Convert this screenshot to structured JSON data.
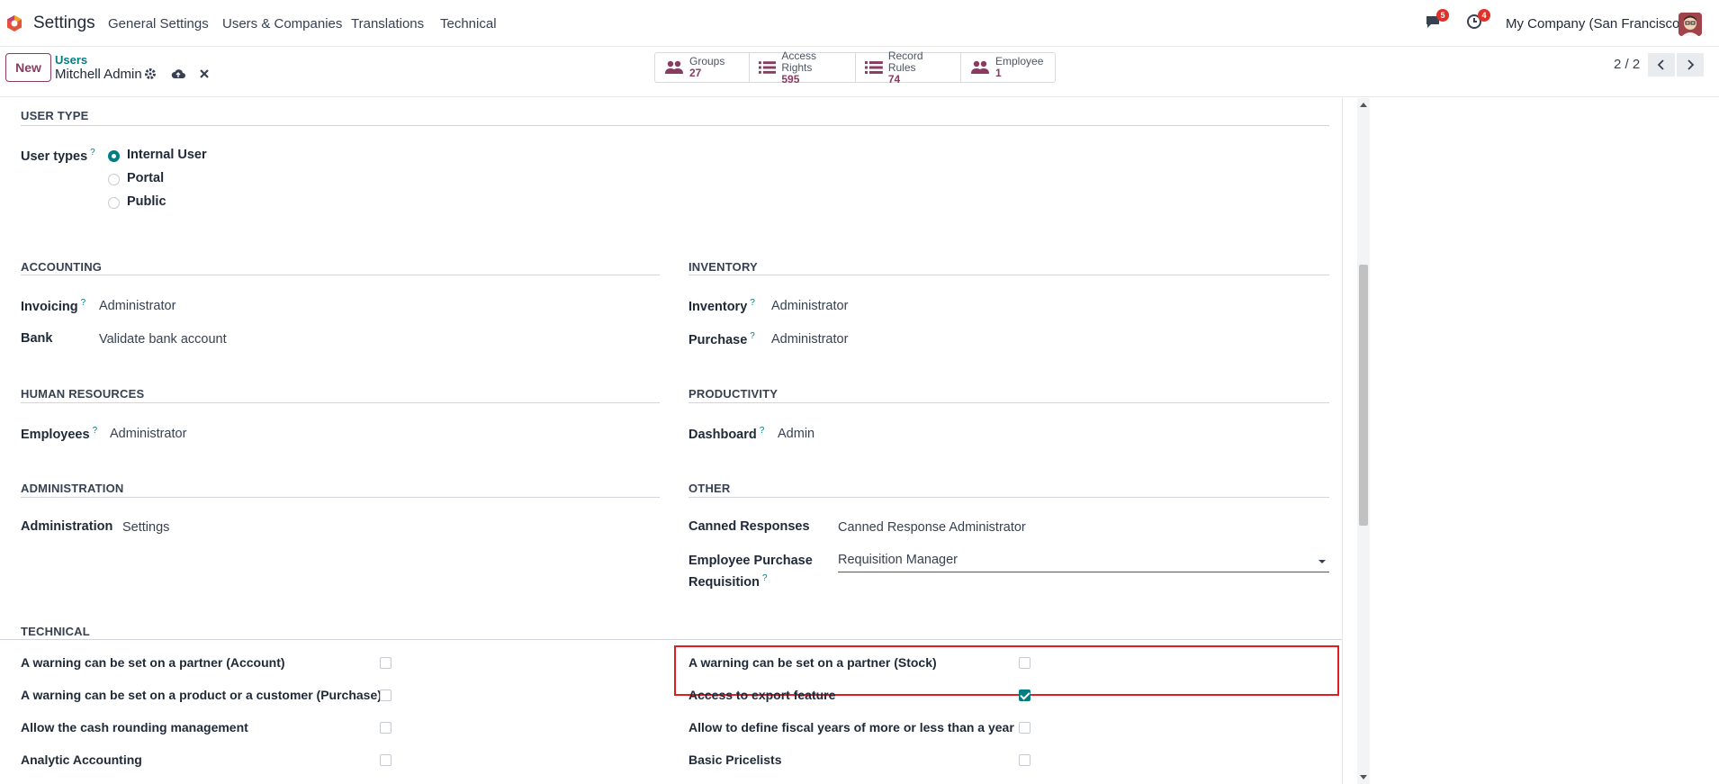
{
  "navbar": {
    "app_name": "Settings",
    "menus": [
      "General Settings",
      "Users & Companies",
      "Translations",
      "Technical"
    ],
    "messages_count": "5",
    "activities_count": "4",
    "company": "My Company (San Francisco)"
  },
  "control_panel": {
    "new_label": "New",
    "breadcrumb_parent": "Users",
    "breadcrumb_current": "Mitchell Admin",
    "smart_buttons": [
      {
        "label": "Groups",
        "value": "27",
        "icon": "users-icon"
      },
      {
        "label": "Access Rights",
        "value": "595",
        "icon": "list-icon"
      },
      {
        "label": "Record Rules",
        "value": "74",
        "icon": "list-icon"
      },
      {
        "label": "Employee",
        "value": "1",
        "icon": "users-icon"
      }
    ],
    "pager": "2 / 2"
  },
  "user_type": {
    "title": "USER TYPE",
    "label": "User types",
    "options": [
      "Internal User",
      "Portal",
      "Public"
    ],
    "selected": "Internal User"
  },
  "sections": {
    "accounting": {
      "title": "ACCOUNTING",
      "fields": [
        {
          "label": "Invoicing",
          "value": "Administrator",
          "help": "?"
        },
        {
          "label": "Bank",
          "value": "Validate bank account"
        }
      ]
    },
    "inventory": {
      "title": "INVENTORY",
      "fields": [
        {
          "label": "Inventory",
          "value": "Administrator",
          "help": "?"
        },
        {
          "label": "Purchase",
          "value": "Administrator",
          "help": "?"
        }
      ]
    },
    "human_resources": {
      "title": "HUMAN RESOURCES",
      "fields": [
        {
          "label": "Employees",
          "value": "Administrator",
          "help": "?"
        }
      ]
    },
    "productivity": {
      "title": "PRODUCTIVITY",
      "fields": [
        {
          "label": "Dashboard",
          "value": "Admin",
          "help": "?"
        }
      ]
    },
    "administration": {
      "title": "ADMINISTRATION",
      "fields": [
        {
          "label": "Administration",
          "value": "Settings"
        }
      ]
    },
    "other": {
      "title": "OTHER",
      "fields": [
        {
          "label": "Canned Responses",
          "value": "Canned Response Administrator"
        },
        {
          "label_line1": "Employee Purchase",
          "label_line2": "Requisition",
          "value": "Requisition Manager",
          "help": "?"
        }
      ]
    }
  },
  "technical": {
    "title": "TECHNICAL",
    "left": [
      {
        "label": "A warning can be set on a partner (Account)",
        "checked": false
      },
      {
        "label": "A warning can be set on a product or a customer (Purchase)",
        "checked": false
      },
      {
        "label": "Allow the cash rounding management",
        "checked": false
      },
      {
        "label": "Analytic Accounting",
        "checked": false
      }
    ],
    "right": [
      {
        "label": "A warning can be set on a partner (Stock)",
        "checked": false
      },
      {
        "label": "Access to export feature",
        "checked": true
      },
      {
        "label": "Allow to define fiscal years of more or less than a year",
        "checked": false
      },
      {
        "label": "Basic Pricelists",
        "checked": false
      }
    ]
  },
  "colors": {
    "brand": "#8a3b62",
    "accent": "#017e84",
    "highlight": "#e11d21"
  }
}
